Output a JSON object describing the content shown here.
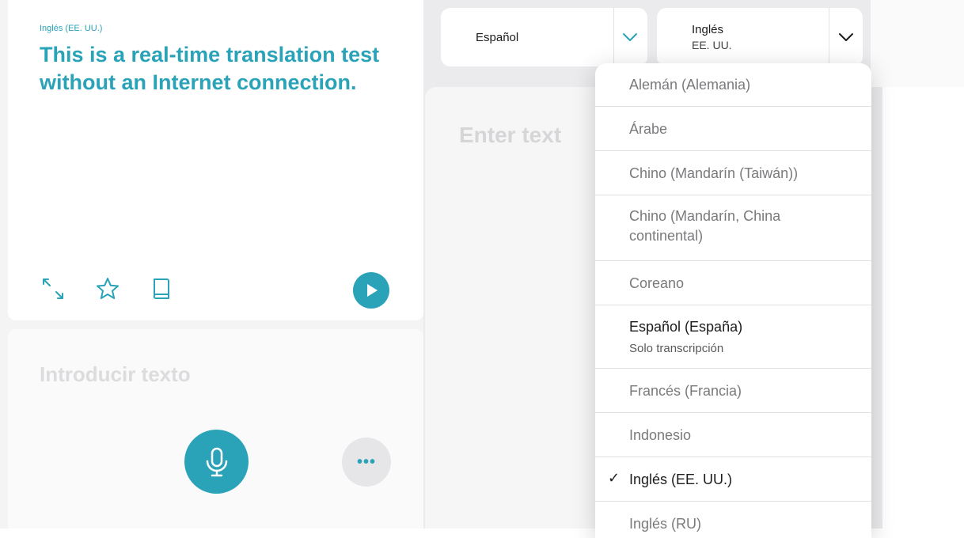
{
  "left": {
    "source_lang_label": "Inglés (EE. UU.)",
    "translated_text": "This is a real-time translation test without an Internet connection.",
    "input_placeholder": "Introducir texto",
    "more_label": "•••"
  },
  "right": {
    "from_lang": {
      "name": "Español"
    },
    "to_lang": {
      "name": "Inglés",
      "sub": "EE. UU."
    },
    "enter_placeholder": "Enter text"
  },
  "dropdown": {
    "items": [
      {
        "label": "Alemán (Alemania)"
      },
      {
        "label": "Árabe"
      },
      {
        "label": "Chino (Mandarín (Taiwán))"
      },
      {
        "label": "Chino (Mandarín, China continental)"
      },
      {
        "label": "Coreano"
      },
      {
        "label": "Español (España)",
        "sub": "Solo transcripción"
      },
      {
        "label": "Francés (Francia)"
      },
      {
        "label": "Indonesio"
      },
      {
        "label": "Inglés (EE. UU.)",
        "check": "✓"
      },
      {
        "label": "Inglés (RU)"
      }
    ]
  },
  "colors": {
    "accent": "#2aa3b8",
    "background": "#ffffff",
    "panel": "#ebebed"
  },
  "icons": [
    "expand-icon",
    "star-icon",
    "book-icon",
    "play-icon",
    "microphone-icon",
    "chevron-down-icon",
    "checkmark-icon"
  ]
}
